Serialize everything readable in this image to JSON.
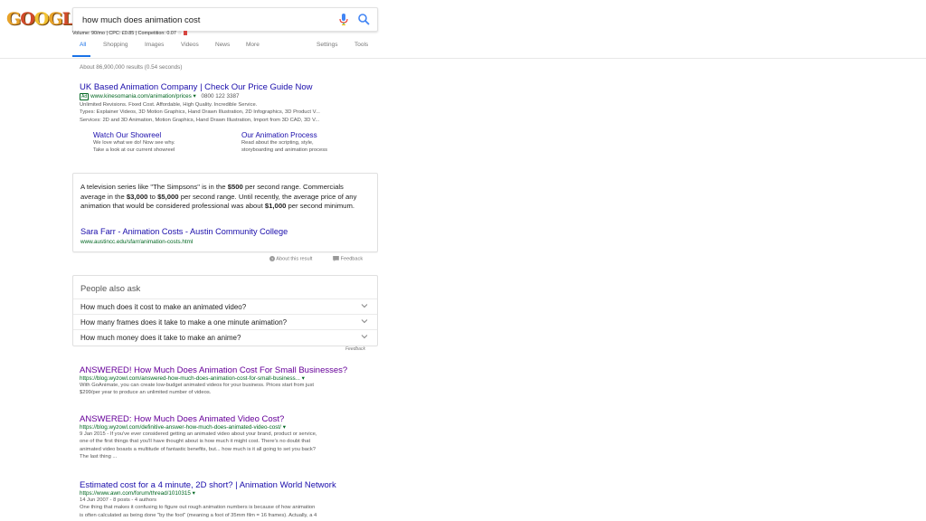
{
  "search": {
    "logo_text": "GOOGLE",
    "query": "how much does animation cost"
  },
  "keyword_bar": {
    "text": "Volume: 90/mo | CPC: £0.85 | Competition: 0.07"
  },
  "tabs": [
    {
      "label": "All",
      "active": true
    },
    {
      "label": "Shopping"
    },
    {
      "label": "Images"
    },
    {
      "label": "Videos"
    },
    {
      "label": "News"
    },
    {
      "label": "More"
    },
    {
      "label": "Settings"
    },
    {
      "label": "Tools"
    }
  ],
  "results_count": "About 86,900,000 results (0.54 seconds)",
  "ad": {
    "title": "UK Based Animation Company | Check Our Price Guide Now",
    "badge": "Ad",
    "url": "www.kinesomania.com/animation/prices",
    "phone": "0800 122 3387",
    "lines": [
      "Unlimited Revisions. Fixed Cost. Affordable, High Quality. Incredible Service.",
      "Types: Explainer Videos, 3D Motion Graphics, Hand Drawn Illustration, 2D Infographics, 3D Product V...",
      "Services: 2D and 3D Animation, Motion Graphics, Hand Drawn Illustration, Import from 3D CAD, 3D V..."
    ],
    "sitelinks": [
      {
        "title": "Watch Our Showreel",
        "lines": [
          "We love what we do! Now see why.",
          "Take a look at our current showreel"
        ]
      },
      {
        "title": "Our Animation Process",
        "lines": [
          "Read about the scripting, style,",
          "storyboarding and animation process"
        ]
      }
    ]
  },
  "featured_snippet": {
    "p1": "A television series like \"The Simpsons\" is in the ",
    "b1": "$500",
    "p2": " per second range. Commercials average in the ",
    "b2": "$3,000",
    "p3": " to ",
    "b3": "$5,000",
    "p4": " per second range. Until recently, the average price of any animation that would be considered professional was about ",
    "b4": "$1,000",
    "p5": " per second minimum.",
    "title": "Sara Farr - Animation Costs - Austin Community College",
    "url": "www.austincc.edu/sfarr/animation-costs.html",
    "about": "About this result",
    "feedback": "Feedback"
  },
  "people_also_ask": {
    "title": "People also ask",
    "questions": [
      "How much does it cost to make an animated video?",
      "How many frames does it take to make a one minute animation?",
      "How much money does it take to make an anime?"
    ],
    "feedback": "Feedback"
  },
  "organic": [
    {
      "title": "ANSWERED! How Much Does Animation Cost For Small Businesses?",
      "url": "https://blog.wyzowl.com/answered-how-much-does-animation-cost-for-small-business...",
      "lines": [
        "With GoAnimate, you can create low-budget animated videos for your business. Prices start from just",
        "$299/per year to produce an unlimited number of videos."
      ]
    },
    {
      "title": "ANSWERED: How Much Does Animated Video Cost?",
      "url": "https://blog.wyzowl.com/definitive-answer-how-much-does-animated-video-cost/",
      "lines": [
        "9 Jan 2015 - If you've ever considered getting an animated video about your brand, product or service,",
        "one of the first things that you'll have thought about is how much it might cost. There's no doubt that",
        "animated video boasts a multitude of fantastic benefits, but... how much is it all going to set you back?",
        "The last thing ..."
      ]
    },
    {
      "title": "Estimated cost for a 4 minute, 2D short? | Animation World Network",
      "url": "https://www.awn.com/forum/thread/1010315",
      "lines": [
        "14 Jun 2007 - 8 posts - 4 authors",
        "One thing that makes it confusing to figure out rough animation numbers is because of how animation",
        "is often calculated as being done \"by the foot\" (meaning a foot of 35mm film = 16 frames). Actually, a 4"
      ]
    }
  ],
  "colors": {
    "link": "#1a0dab",
    "visited": "#660099",
    "url": "#006621",
    "accent": "#1a73e8"
  }
}
